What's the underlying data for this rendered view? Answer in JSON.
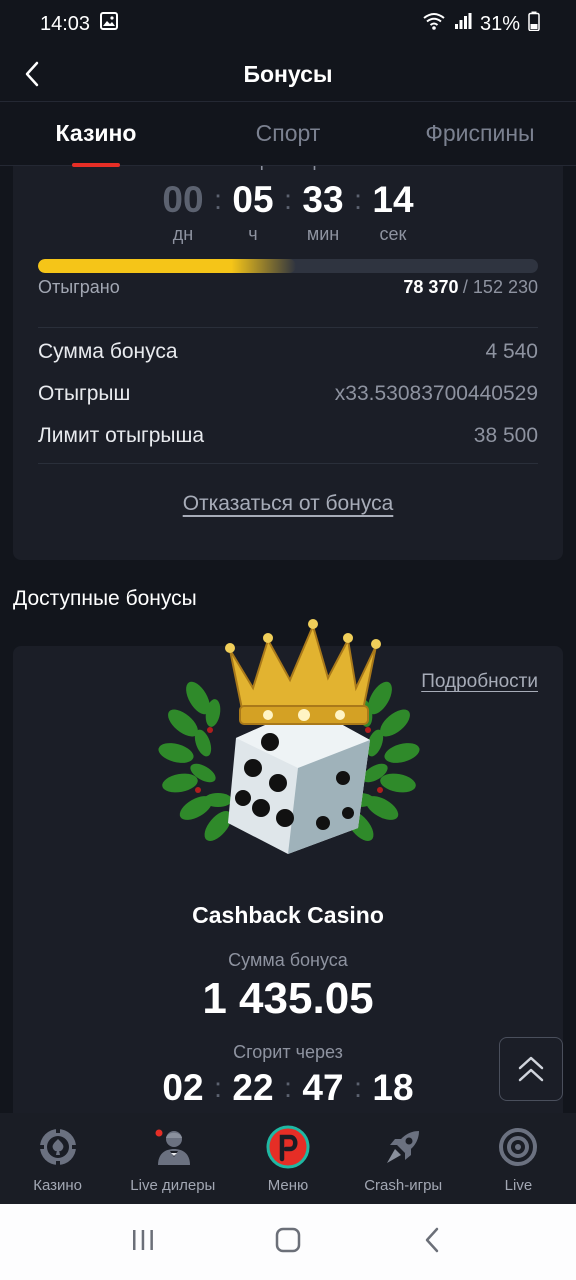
{
  "status_bar": {
    "time": "14:03",
    "battery": "31%"
  },
  "header": {
    "title": "Бонусы"
  },
  "tabs": [
    {
      "label": "Казино",
      "active": true
    },
    {
      "label": "Спорт",
      "active": false
    },
    {
      "label": "Фриспины",
      "active": false
    }
  ],
  "active_bonus": {
    "burns_in_label": "Сгорит через:",
    "timer": [
      {
        "value": "00",
        "unit": "дн"
      },
      {
        "value": "05",
        "unit": "ч"
      },
      {
        "value": "33",
        "unit": "мин"
      },
      {
        "value": "14",
        "unit": "сек"
      }
    ],
    "played_label": "Отыграно",
    "played_value": "78 370",
    "played_total": "/ 152 230",
    "progress_fraction": 0.515,
    "rows": [
      {
        "label": "Сумма бонуса",
        "value": "4 540"
      },
      {
        "label": "Отыгрыш",
        "value": "x33.53083700440529"
      },
      {
        "label": "Лимит отыгрыша",
        "value": "38 500"
      }
    ],
    "refuse_label": "Отказаться от бонуса"
  },
  "available": {
    "section_title": "Доступные бонусы",
    "details_label": "Подробности",
    "bonus_name": "Cashback Casino",
    "sum_label": "Сумма бонуса",
    "sum_value": "1 435.05",
    "burn_label": "Сгорит через",
    "timer": [
      "02",
      "22",
      "47",
      "18"
    ]
  },
  "bottom_nav": [
    {
      "label": "Казино",
      "icon": "casino-chip-icon"
    },
    {
      "label": "Live дилеры",
      "icon": "live-dealer-icon"
    },
    {
      "label": "Меню",
      "icon": "menu-logo-icon"
    },
    {
      "label": "Crash-игры",
      "icon": "rocket-icon"
    },
    {
      "label": "Live",
      "icon": "live-target-icon"
    }
  ],
  "colors": {
    "accent_red": "#e62e26",
    "progress_yellow": "#f5c518",
    "menu_teal": "#1fb8a3"
  }
}
